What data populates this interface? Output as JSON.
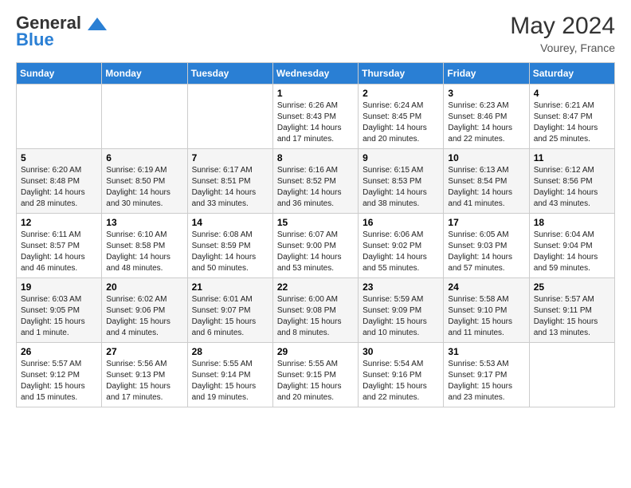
{
  "header": {
    "logo_line1": "General",
    "logo_line2": "Blue",
    "month_year": "May 2024",
    "location": "Vourey, France"
  },
  "days_of_week": [
    "Sunday",
    "Monday",
    "Tuesday",
    "Wednesday",
    "Thursday",
    "Friday",
    "Saturday"
  ],
  "weeks": [
    [
      {
        "day": "",
        "info": ""
      },
      {
        "day": "",
        "info": ""
      },
      {
        "day": "",
        "info": ""
      },
      {
        "day": "1",
        "info": "Sunrise: 6:26 AM\nSunset: 8:43 PM\nDaylight: 14 hours\nand 17 minutes."
      },
      {
        "day": "2",
        "info": "Sunrise: 6:24 AM\nSunset: 8:45 PM\nDaylight: 14 hours\nand 20 minutes."
      },
      {
        "day": "3",
        "info": "Sunrise: 6:23 AM\nSunset: 8:46 PM\nDaylight: 14 hours\nand 22 minutes."
      },
      {
        "day": "4",
        "info": "Sunrise: 6:21 AM\nSunset: 8:47 PM\nDaylight: 14 hours\nand 25 minutes."
      }
    ],
    [
      {
        "day": "5",
        "info": "Sunrise: 6:20 AM\nSunset: 8:48 PM\nDaylight: 14 hours\nand 28 minutes."
      },
      {
        "day": "6",
        "info": "Sunrise: 6:19 AM\nSunset: 8:50 PM\nDaylight: 14 hours\nand 30 minutes."
      },
      {
        "day": "7",
        "info": "Sunrise: 6:17 AM\nSunset: 8:51 PM\nDaylight: 14 hours\nand 33 minutes."
      },
      {
        "day": "8",
        "info": "Sunrise: 6:16 AM\nSunset: 8:52 PM\nDaylight: 14 hours\nand 36 minutes."
      },
      {
        "day": "9",
        "info": "Sunrise: 6:15 AM\nSunset: 8:53 PM\nDaylight: 14 hours\nand 38 minutes."
      },
      {
        "day": "10",
        "info": "Sunrise: 6:13 AM\nSunset: 8:54 PM\nDaylight: 14 hours\nand 41 minutes."
      },
      {
        "day": "11",
        "info": "Sunrise: 6:12 AM\nSunset: 8:56 PM\nDaylight: 14 hours\nand 43 minutes."
      }
    ],
    [
      {
        "day": "12",
        "info": "Sunrise: 6:11 AM\nSunset: 8:57 PM\nDaylight: 14 hours\nand 46 minutes."
      },
      {
        "day": "13",
        "info": "Sunrise: 6:10 AM\nSunset: 8:58 PM\nDaylight: 14 hours\nand 48 minutes."
      },
      {
        "day": "14",
        "info": "Sunrise: 6:08 AM\nSunset: 8:59 PM\nDaylight: 14 hours\nand 50 minutes."
      },
      {
        "day": "15",
        "info": "Sunrise: 6:07 AM\nSunset: 9:00 PM\nDaylight: 14 hours\nand 53 minutes."
      },
      {
        "day": "16",
        "info": "Sunrise: 6:06 AM\nSunset: 9:02 PM\nDaylight: 14 hours\nand 55 minutes."
      },
      {
        "day": "17",
        "info": "Sunrise: 6:05 AM\nSunset: 9:03 PM\nDaylight: 14 hours\nand 57 minutes."
      },
      {
        "day": "18",
        "info": "Sunrise: 6:04 AM\nSunset: 9:04 PM\nDaylight: 14 hours\nand 59 minutes."
      }
    ],
    [
      {
        "day": "19",
        "info": "Sunrise: 6:03 AM\nSunset: 9:05 PM\nDaylight: 15 hours\nand 1 minute."
      },
      {
        "day": "20",
        "info": "Sunrise: 6:02 AM\nSunset: 9:06 PM\nDaylight: 15 hours\nand 4 minutes."
      },
      {
        "day": "21",
        "info": "Sunrise: 6:01 AM\nSunset: 9:07 PM\nDaylight: 15 hours\nand 6 minutes."
      },
      {
        "day": "22",
        "info": "Sunrise: 6:00 AM\nSunset: 9:08 PM\nDaylight: 15 hours\nand 8 minutes."
      },
      {
        "day": "23",
        "info": "Sunrise: 5:59 AM\nSunset: 9:09 PM\nDaylight: 15 hours\nand 10 minutes."
      },
      {
        "day": "24",
        "info": "Sunrise: 5:58 AM\nSunset: 9:10 PM\nDaylight: 15 hours\nand 11 minutes."
      },
      {
        "day": "25",
        "info": "Sunrise: 5:57 AM\nSunset: 9:11 PM\nDaylight: 15 hours\nand 13 minutes."
      }
    ],
    [
      {
        "day": "26",
        "info": "Sunrise: 5:57 AM\nSunset: 9:12 PM\nDaylight: 15 hours\nand 15 minutes."
      },
      {
        "day": "27",
        "info": "Sunrise: 5:56 AM\nSunset: 9:13 PM\nDaylight: 15 hours\nand 17 minutes."
      },
      {
        "day": "28",
        "info": "Sunrise: 5:55 AM\nSunset: 9:14 PM\nDaylight: 15 hours\nand 19 minutes."
      },
      {
        "day": "29",
        "info": "Sunrise: 5:55 AM\nSunset: 9:15 PM\nDaylight: 15 hours\nand 20 minutes."
      },
      {
        "day": "30",
        "info": "Sunrise: 5:54 AM\nSunset: 9:16 PM\nDaylight: 15 hours\nand 22 minutes."
      },
      {
        "day": "31",
        "info": "Sunrise: 5:53 AM\nSunset: 9:17 PM\nDaylight: 15 hours\nand 23 minutes."
      },
      {
        "day": "",
        "info": ""
      }
    ]
  ]
}
